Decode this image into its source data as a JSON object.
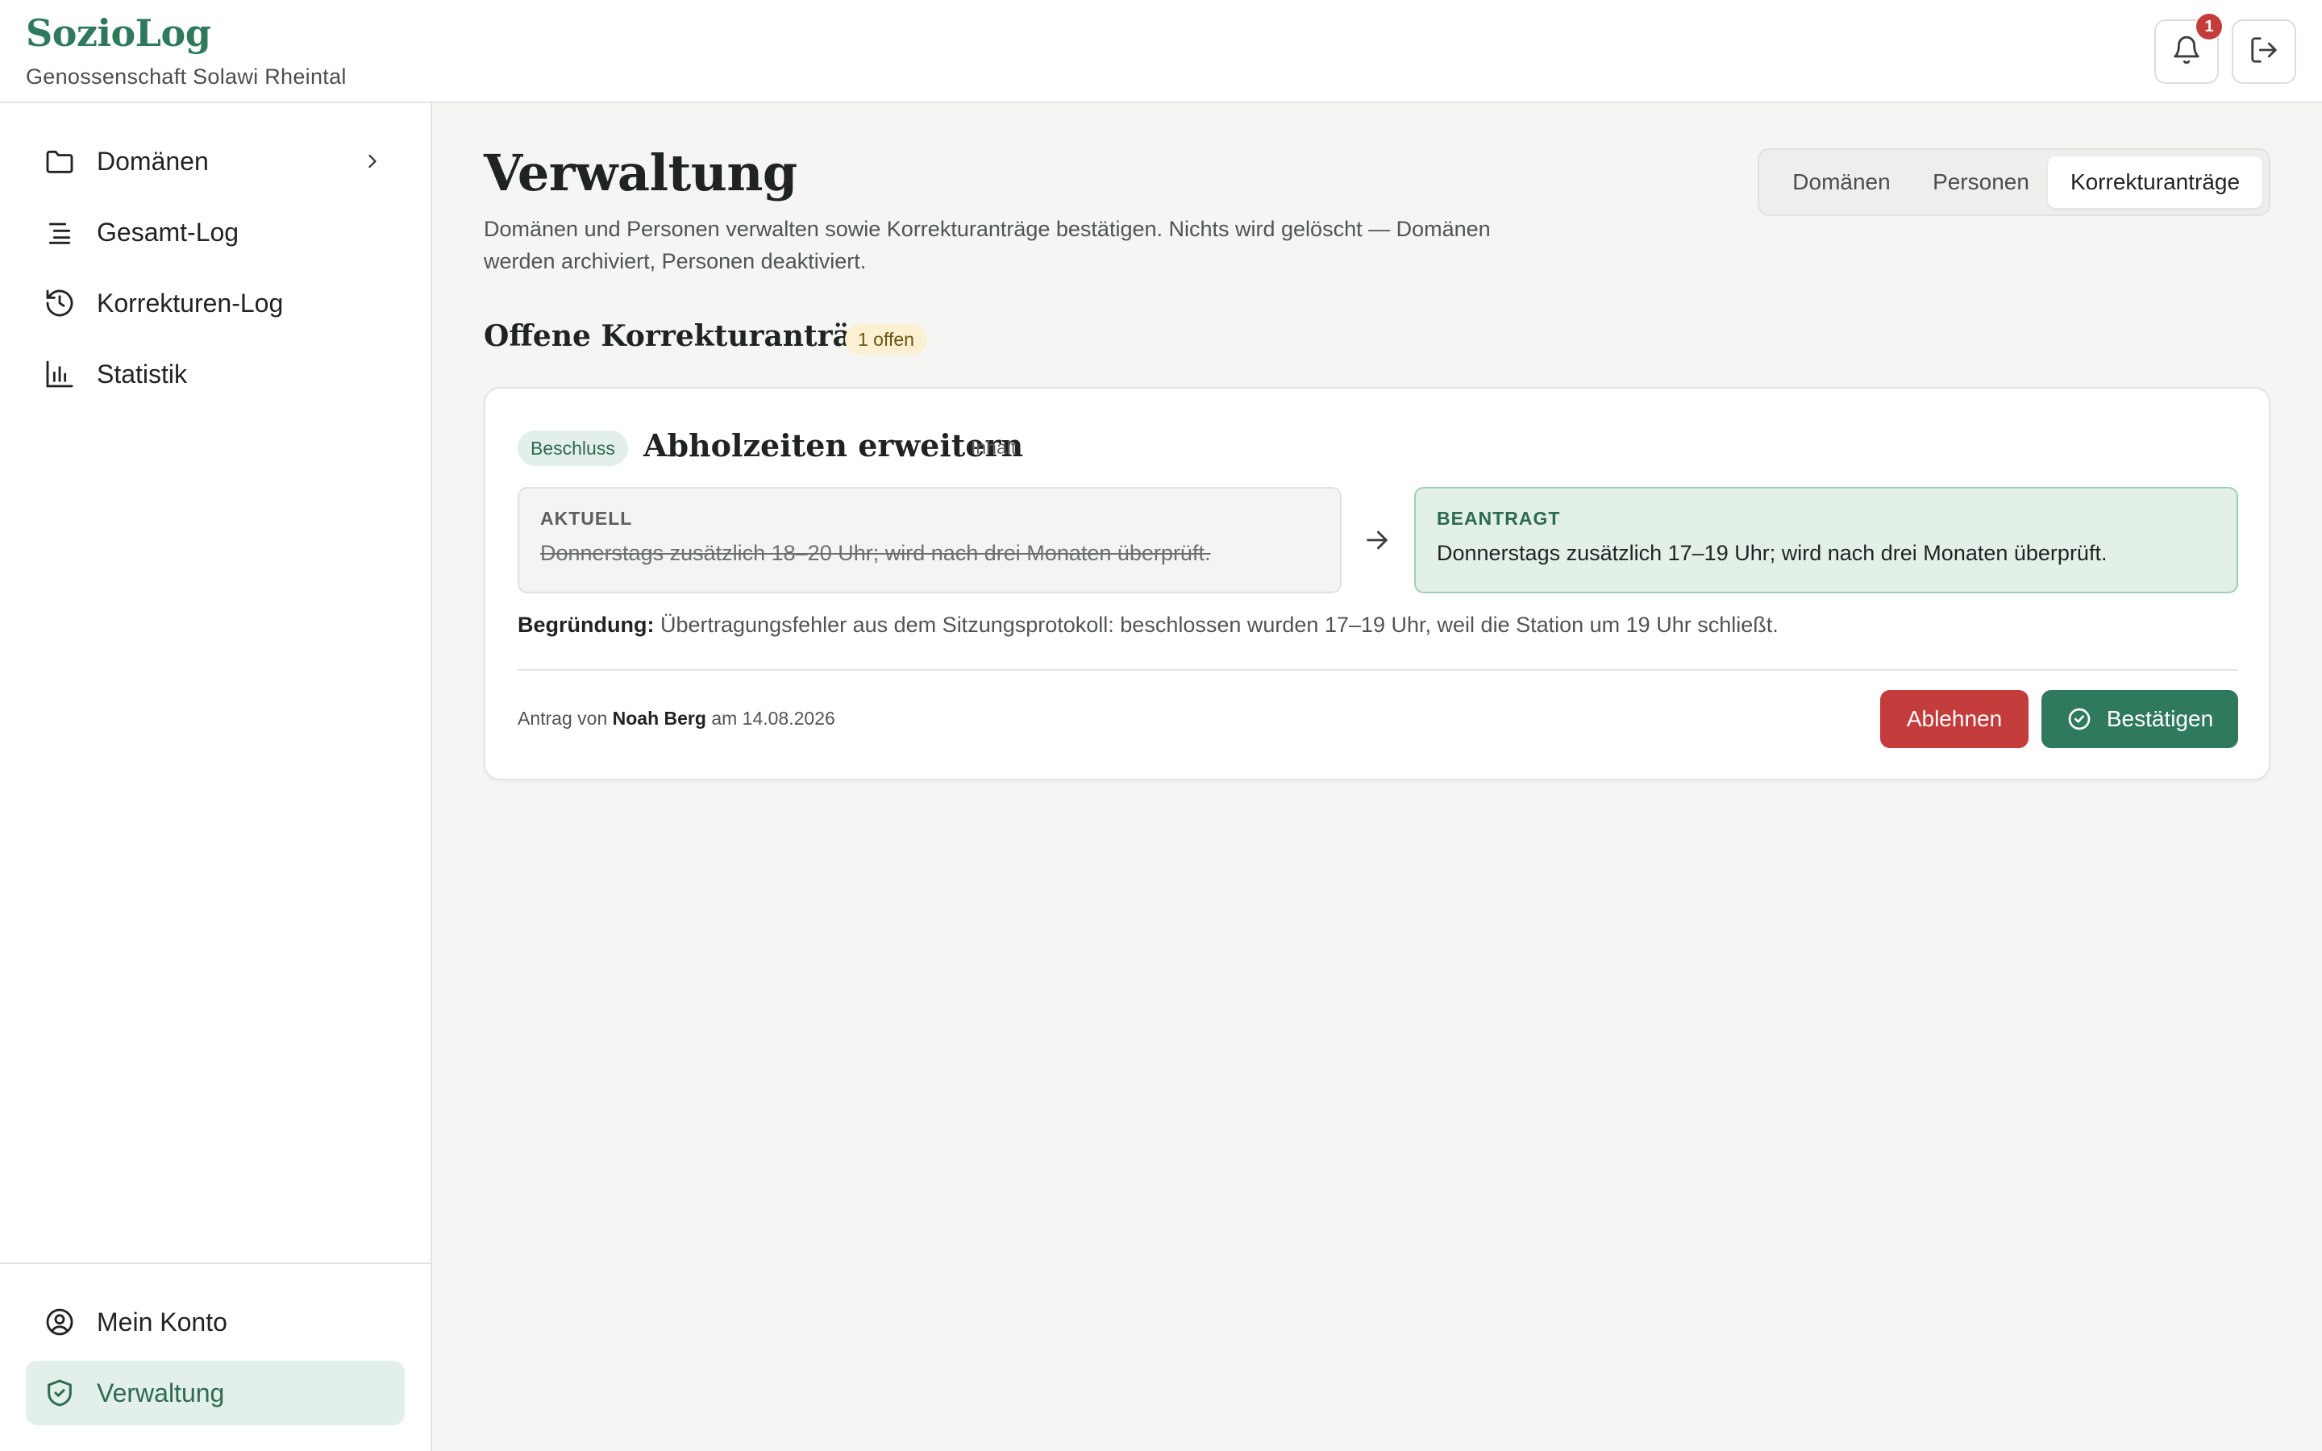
{
  "brand": {
    "title": "SozioLog",
    "subtitle": "Genossenschaft Solawi Rheintal"
  },
  "header": {
    "notification_count": "1",
    "icons": [
      "bell-icon",
      "logout-icon"
    ]
  },
  "sidebar": {
    "items": [
      {
        "label": "Domänen",
        "icon": "folder-icon",
        "has_chevron": true
      },
      {
        "label": "Gesamt-Log",
        "icon": "list-icon"
      },
      {
        "label": "Korrekturen-Log",
        "icon": "history-icon"
      },
      {
        "label": "Statistik",
        "icon": "bar-chart-icon"
      }
    ],
    "bottom_items": [
      {
        "label": "Mein Konto",
        "icon": "user-circle-icon"
      },
      {
        "label": "Verwaltung",
        "icon": "shield-check-icon",
        "active": true
      }
    ]
  },
  "main": {
    "title": "Verwaltung",
    "description": "Domänen und Personen verwalten sowie Korrekturanträge bestätigen. Nichts wird gelöscht — Domänen werden archiviert, Personen deaktiviert.",
    "tabs": [
      {
        "label": "Domänen"
      },
      {
        "label": "Personen"
      },
      {
        "label": "Korrekturanträge",
        "active": true
      }
    ],
    "section_title": "Offene Korrekturanträge",
    "open_count": "1 offen",
    "request": {
      "type_badge": "Beschluss",
      "title": "Abholzeiten erweitern",
      "field": "Inhalt",
      "current_caption": "AKTUELL",
      "current_value": "Donnerstags zusätzlich 18–20 Uhr; wird nach drei Monaten überprüft.",
      "proposed_caption": "BEANTRAGT",
      "proposed_value": "Donnerstags zusätzlich 17–19 Uhr; wird nach drei Monaten überprüft.",
      "reason_label": "Begründung:",
      "reason_text": "Übertragungsfehler aus dem Sitzungsprotokoll: beschlossen wurden 17–19 Uhr, weil die Station um 19 Uhr schließt.",
      "meta_prefix": "Antrag von",
      "author": "Noah Berg",
      "meta_mid": "am",
      "date": "14.08.2026",
      "reject_label": "Ablehnen",
      "confirm_label": "Bestätigen"
    }
  },
  "colors": {
    "brand": "#2f7a5c",
    "danger": "#c43c3c",
    "active_bg": "#e3efe9",
    "proposed_bg": "#e3f0e8",
    "badge_warn_bg": "#fbf0d2"
  }
}
